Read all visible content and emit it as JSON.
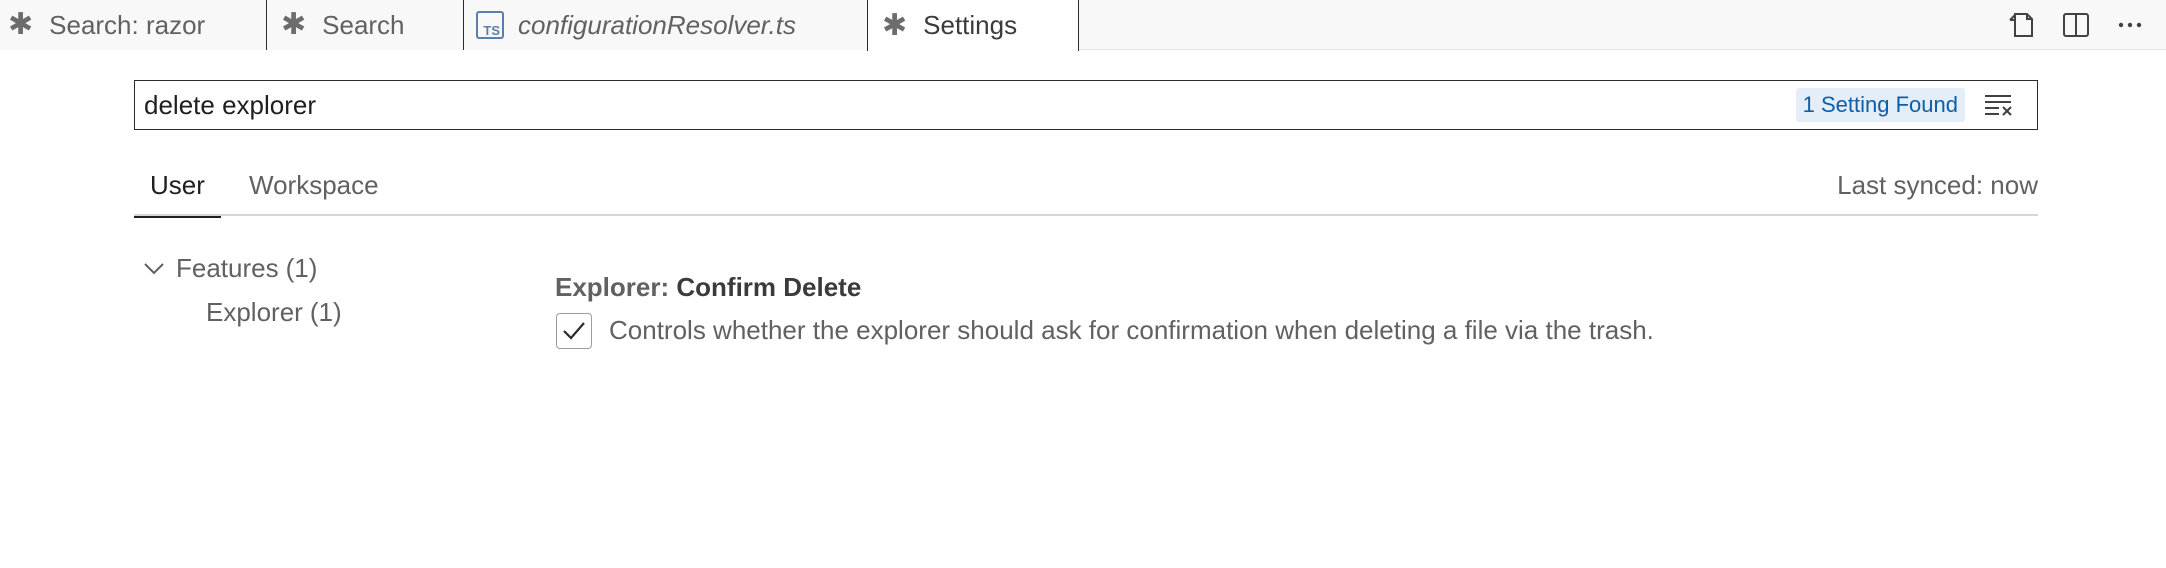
{
  "tabs": [
    {
      "label": "Search: razor",
      "icon": "asterisk-icon"
    },
    {
      "label": "Search",
      "icon": "asterisk-icon"
    },
    {
      "label": "configurationResolver.ts",
      "icon": "typescript-file-icon",
      "icon_text": "TS"
    },
    {
      "label": "Settings",
      "icon": "asterisk-icon",
      "active": true
    }
  ],
  "tab_actions": [
    "open-settings-json-icon",
    "split-editor-icon",
    "more-actions-icon"
  ],
  "search": {
    "value": "delete explorer",
    "results_badge": "1 Setting Found"
  },
  "scope_tabs": {
    "user": "User",
    "workspace": "Workspace",
    "last_synced": "Last synced: now"
  },
  "toc": [
    {
      "label": "Features",
      "count": "(1)",
      "expanded": true
    },
    {
      "label": "Explorer",
      "count": "(1)"
    }
  ],
  "setting": {
    "category": "Explorer: ",
    "name": "Confirm Delete",
    "checked": true,
    "description": "Controls whether the explorer should ask for confirmation when deleting a file via the trash."
  },
  "colors": {
    "badge_bg": "#e3eef9",
    "badge_text": "#0f5ea8",
    "tab_bar_bg": "#f8f8f8"
  }
}
